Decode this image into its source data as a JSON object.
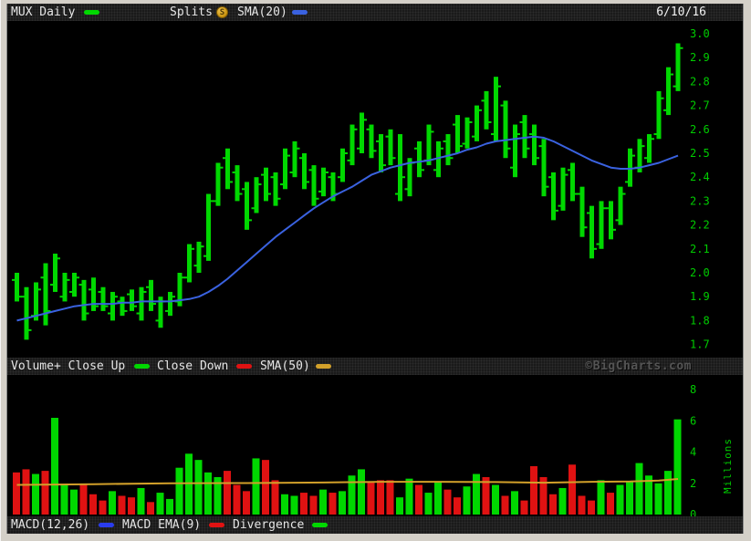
{
  "header": {
    "date": "6/10/16"
  },
  "legend_top": {
    "symbol_label": "MUX Daily",
    "splits_label": "Splits",
    "splits_badge": "S",
    "sma_label": "SMA(20)"
  },
  "legend_volume": {
    "volume_label": "Volume+ Close Up",
    "close_down_label": "Close Down",
    "sma_label": "SMA(50)",
    "watermark": "©BigCharts.com"
  },
  "legend_macd": {
    "macd_label": "MACD(12,26)",
    "ema_label": "MACD EMA(9)",
    "divergence_label": "Divergence"
  },
  "colors": {
    "up": "#00d800",
    "down": "#e01212",
    "sma20": "#3a62e0",
    "sma50": "#d2a02a",
    "macd_blue": "#2a3cee",
    "axis_text": "#00cc00",
    "legend_text": "#e6e6e6",
    "watermark": "#545454",
    "panel_bg": "#000000"
  },
  "chart_data": [
    {
      "type": "ohlc-bar",
      "title": "MUX Daily",
      "last_date": "6/10/16",
      "ylim": [
        1.7,
        3.0
      ],
      "yticks": [
        "3.0",
        "2.9",
        "2.8",
        "2.7",
        "2.6",
        "2.5",
        "2.4",
        "2.3",
        "2.2",
        "2.1",
        "2.0",
        "1.9",
        "1.8",
        "1.7"
      ],
      "legend": [
        "MUX Daily",
        "Splits",
        "SMA(20)"
      ],
      "grid": false,
      "series": [
        {
          "name": "MUX daily OHLC",
          "ohlc": [
            [
              1.97,
              2.0,
              1.88,
              1.9
            ],
            [
              1.9,
              1.94,
              1.72,
              1.76
            ],
            [
              1.82,
              1.96,
              1.8,
              1.93
            ],
            [
              1.98,
              2.04,
              1.78,
              1.84
            ],
            [
              1.95,
              2.08,
              1.92,
              2.06
            ],
            [
              1.9,
              2.0,
              1.88,
              1.97
            ],
            [
              1.92,
              2.0,
              1.9,
              1.98
            ],
            [
              1.95,
              1.97,
              1.8,
              1.83
            ],
            [
              1.93,
              1.98,
              1.84,
              1.86
            ],
            [
              1.92,
              1.94,
              1.84,
              1.86
            ],
            [
              1.83,
              1.92,
              1.8,
              1.9
            ],
            [
              1.88,
              1.9,
              1.82,
              1.84
            ],
            [
              1.91,
              1.93,
              1.84,
              1.86
            ],
            [
              1.83,
              1.94,
              1.8,
              1.92
            ],
            [
              1.94,
              1.97,
              1.84,
              1.87
            ],
            [
              1.8,
              1.9,
              1.77,
              1.88
            ],
            [
              1.84,
              1.92,
              1.82,
              1.9
            ],
            [
              1.88,
              2.0,
              1.86,
              1.98
            ],
            [
              1.98,
              2.12,
              1.96,
              2.1
            ],
            [
              2.03,
              2.13,
              2.0,
              2.11
            ],
            [
              2.07,
              2.33,
              2.05,
              2.3
            ],
            [
              2.3,
              2.46,
              2.28,
              2.44
            ],
            [
              2.48,
              2.52,
              2.35,
              2.38
            ],
            [
              2.42,
              2.45,
              2.3,
              2.33
            ],
            [
              2.35,
              2.38,
              2.18,
              2.22
            ],
            [
              2.27,
              2.4,
              2.25,
              2.37
            ],
            [
              2.41,
              2.44,
              2.3,
              2.33
            ],
            [
              2.4,
              2.42,
              2.28,
              2.31
            ],
            [
              2.37,
              2.52,
              2.35,
              2.49
            ],
            [
              2.42,
              2.55,
              2.4,
              2.52
            ],
            [
              2.48,
              2.5,
              2.35,
              2.38
            ],
            [
              2.43,
              2.45,
              2.28,
              2.31
            ],
            [
              2.34,
              2.44,
              2.32,
              2.42
            ],
            [
              2.4,
              2.42,
              2.3,
              2.33
            ],
            [
              2.4,
              2.52,
              2.38,
              2.5
            ],
            [
              2.47,
              2.62,
              2.45,
              2.6
            ],
            [
              2.52,
              2.67,
              2.5,
              2.64
            ],
            [
              2.6,
              2.62,
              2.48,
              2.51
            ],
            [
              2.55,
              2.58,
              2.42,
              2.45
            ],
            [
              2.57,
              2.6,
              2.45,
              2.48
            ],
            [
              2.33,
              2.58,
              2.3,
              2.4
            ],
            [
              2.35,
              2.48,
              2.32,
              2.46
            ],
            [
              2.52,
              2.55,
              2.4,
              2.43
            ],
            [
              2.47,
              2.62,
              2.45,
              2.59
            ],
            [
              2.43,
              2.55,
              2.4,
              2.52
            ],
            [
              2.55,
              2.58,
              2.45,
              2.48
            ],
            [
              2.62,
              2.66,
              2.5,
              2.53
            ],
            [
              2.54,
              2.65,
              2.52,
              2.63
            ],
            [
              2.57,
              2.7,
              2.55,
              2.68
            ],
            [
              2.72,
              2.76,
              2.6,
              2.63
            ],
            [
              2.58,
              2.82,
              2.55,
              2.78
            ],
            [
              2.7,
              2.72,
              2.48,
              2.52
            ],
            [
              2.44,
              2.62,
              2.4,
              2.58
            ],
            [
              2.63,
              2.66,
              2.48,
              2.52
            ],
            [
              2.58,
              2.62,
              2.45,
              2.48
            ],
            [
              2.53,
              2.56,
              2.32,
              2.36
            ],
            [
              2.4,
              2.42,
              2.22,
              2.26
            ],
            [
              2.28,
              2.44,
              2.26,
              2.41
            ],
            [
              2.43,
              2.46,
              2.3,
              2.33
            ],
            [
              2.33,
              2.36,
              2.15,
              2.19
            ],
            [
              2.25,
              2.28,
              2.06,
              2.1
            ],
            [
              2.12,
              2.3,
              2.1,
              2.27
            ],
            [
              2.27,
              2.3,
              2.14,
              2.18
            ],
            [
              2.22,
              2.36,
              2.2,
              2.33
            ],
            [
              2.38,
              2.52,
              2.36,
              2.49
            ],
            [
              2.44,
              2.56,
              2.42,
              2.53
            ],
            [
              2.48,
              2.58,
              2.46,
              2.56
            ],
            [
              2.58,
              2.76,
              2.56,
              2.73
            ],
            [
              2.68,
              2.86,
              2.66,
              2.83
            ],
            [
              2.78,
              2.96,
              2.76,
              2.94
            ]
          ]
        },
        {
          "name": "SMA(20)",
          "values": [
            1.8,
            1.81,
            1.82,
            1.83,
            1.84,
            1.85,
            1.86,
            1.865,
            1.87,
            1.87,
            1.87,
            1.875,
            1.875,
            1.88,
            1.88,
            1.88,
            1.88,
            1.885,
            1.89,
            1.9,
            1.92,
            1.945,
            1.975,
            2.01,
            2.045,
            2.08,
            2.115,
            2.15,
            2.18,
            2.21,
            2.24,
            2.27,
            2.295,
            2.32,
            2.34,
            2.36,
            2.385,
            2.41,
            2.425,
            2.44,
            2.45,
            2.46,
            2.465,
            2.47,
            2.48,
            2.49,
            2.5,
            2.515,
            2.525,
            2.54,
            2.55,
            2.555,
            2.56,
            2.565,
            2.57,
            2.565,
            2.55,
            2.53,
            2.51,
            2.49,
            2.47,
            2.455,
            2.44,
            2.435,
            2.435,
            2.44,
            2.45,
            2.46,
            2.475,
            2.49
          ]
        }
      ]
    },
    {
      "type": "bar",
      "title": "Volume+ Close Up / Close Down",
      "ylabel": "Millions",
      "ylim": [
        0,
        8
      ],
      "yticks": [
        "8",
        "6",
        "4",
        "2",
        "0"
      ],
      "color_rule": "green if close >= open else red (from price panel)",
      "values": [
        2.7,
        2.9,
        2.6,
        2.8,
        6.2,
        1.9,
        1.6,
        1.9,
        1.3,
        0.9,
        1.5,
        1.2,
        1.1,
        1.7,
        0.8,
        1.4,
        1.0,
        3.0,
        3.9,
        3.5,
        2.7,
        2.4,
        2.8,
        1.9,
        1.5,
        3.6,
        3.5,
        2.2,
        1.3,
        1.2,
        1.4,
        1.2,
        1.6,
        1.4,
        1.5,
        2.5,
        2.9,
        2.1,
        2.2,
        2.2,
        1.1,
        2.3,
        1.9,
        1.4,
        2.1,
        1.6,
        1.1,
        1.8,
        2.6,
        2.4,
        1.9,
        1.2,
        1.5,
        0.9,
        3.1,
        2.4,
        1.3,
        1.7,
        3.2,
        1.2,
        0.9,
        2.2,
        1.4,
        1.9,
        2.1,
        3.3,
        2.5,
        2.0,
        2.8,
        6.1
      ],
      "series": [
        {
          "name": "SMA(50)",
          "points": [
            [
              0,
              1.9
            ],
            [
              8,
              1.95
            ],
            [
              16,
              2.0
            ],
            [
              24,
              2.02
            ],
            [
              32,
              2.05
            ],
            [
              38,
              2.1
            ],
            [
              44,
              2.1
            ],
            [
              50,
              2.08
            ],
            [
              55,
              2.04
            ],
            [
              60,
              2.1
            ],
            [
              64,
              2.12
            ],
            [
              67,
              2.18
            ],
            [
              69,
              2.28
            ]
          ]
        }
      ]
    }
  ]
}
